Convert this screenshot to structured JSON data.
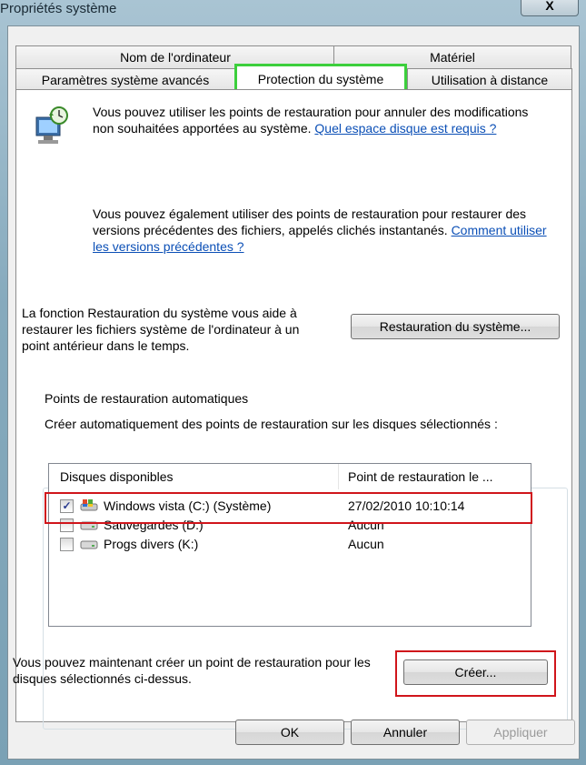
{
  "window": {
    "title": "Propriétés système",
    "close_glyph": "X"
  },
  "tabs": [
    {
      "label": "Nom de l'ordinateur"
    },
    {
      "label": "Matériel"
    },
    {
      "label": "Paramètres système avancés"
    },
    {
      "label": "Protection du système",
      "active": true
    },
    {
      "label": "Utilisation à distance"
    }
  ],
  "intro": {
    "para1": "Vous pouvez utiliser les points de restauration pour annuler des modifications non souhaitées apportées au système.",
    "para1_link": "Quel espace disque est requis ?",
    "para2": "Vous pouvez également utiliser des points de restauration pour restaurer des versions précédentes des fichiers, appelés clichés instantanés.",
    "para2_link": "Comment utiliser les versions précédentes ?"
  },
  "restore": {
    "description": "La fonction Restauration du système vous aide à restaurer les fichiers système de l'ordinateur à un point antérieur dans le temps.",
    "button": "Restauration du système..."
  },
  "auto_points": {
    "legend": "Points de restauration automatiques",
    "description": "Créer automatiquement des points de restauration sur les disques sélectionnés :",
    "columns": [
      "Disques disponibles",
      "Point de restauration le ..."
    ],
    "rows": [
      {
        "name": "Windows vista (C:) (Système)",
        "date": "27/02/2010 10:10:14",
        "checked": true,
        "icon": "system-drive-icon"
      },
      {
        "name": "Sauvegardes (D:)",
        "date": "Aucun",
        "checked": false,
        "icon": "drive-icon"
      },
      {
        "name": "Progs divers (K:)",
        "date": "Aucun",
        "checked": false,
        "icon": "drive-icon"
      }
    ]
  },
  "create": {
    "description": "Vous pouvez maintenant créer un point de restauration pour les disques sélectionnés ci-dessus.",
    "button": "Créer..."
  },
  "footer": {
    "ok": "OK",
    "cancel": "Annuler",
    "apply": "Appliquer"
  },
  "colors": {
    "highlight_green": "#3ccf3c",
    "highlight_red": "#d0151b",
    "link": "#0b4fb6"
  }
}
